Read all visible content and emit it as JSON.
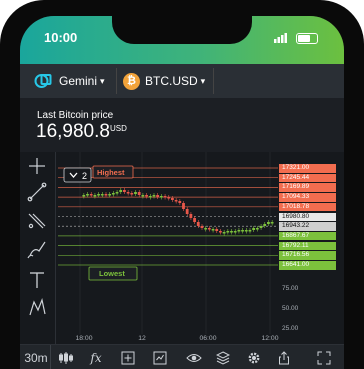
{
  "status": {
    "time": "10:00"
  },
  "toolbar": {
    "exchange_label": "Gemini",
    "exchange_chevron": "▾",
    "symbol_label": "BTC.USD",
    "symbol_chevron": "▾",
    "symbol_icon_glyph": "₿"
  },
  "price": {
    "label": "Last Bitcoin price",
    "value": "16,980.8",
    "currency": "USD"
  },
  "levels": {
    "count_label": "2",
    "highest_label": "Highest",
    "lowest_label": "Lowest"
  },
  "price_tags": [
    {
      "text": "17321.00",
      "color": "#f26d4f"
    },
    {
      "text": "17245.44",
      "color": "#f26d4f"
    },
    {
      "text": "17169.89",
      "color": "#f26d4f"
    },
    {
      "text": "17094.33",
      "color": "#f26d4f"
    },
    {
      "text": "17018.78",
      "color": "#f26d4f"
    },
    {
      "text": "16980.80",
      "color": "#e8e8e8"
    },
    {
      "text": "16943.22",
      "color": "#cfcfcf"
    },
    {
      "text": "16867.67",
      "color": "#7cc13c"
    },
    {
      "text": "16792.11",
      "color": "#7cc13c"
    },
    {
      "text": "16716.56",
      "color": "#7cc13c"
    },
    {
      "text": "16641.00",
      "color": "#7cc13c"
    }
  ],
  "volume_axis": [
    "75.00",
    "50.00",
    "25.00"
  ],
  "time_axis": [
    "18:00",
    "12",
    "06:00",
    "12:00"
  ],
  "bottom_bar": {
    "interval_label": "30m",
    "fx_label": "fx"
  },
  "colors": {
    "up": "#7cc13c",
    "down": "#e8574a",
    "resistance": "#f26d4f",
    "support": "#7cc13c"
  },
  "icons": [
    "crosshair-icon",
    "trendline-icon",
    "fib-tool-icon",
    "brush-icon",
    "text-icon",
    "pattern-icon",
    "candles-icon",
    "fx-icon",
    "add-icon",
    "compare-icon",
    "eye-icon",
    "layers-icon",
    "settings-icon",
    "share-icon",
    "fullscreen-icon"
  ]
}
